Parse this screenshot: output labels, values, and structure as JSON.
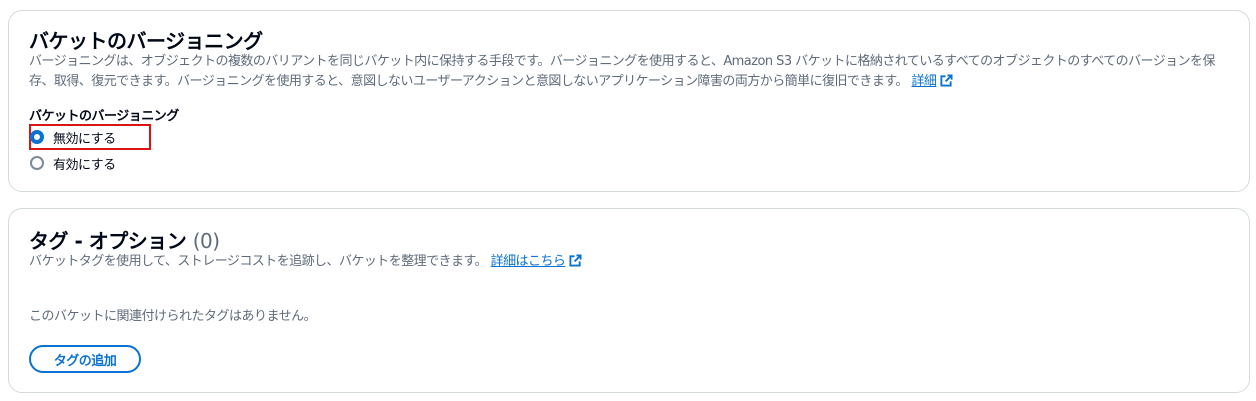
{
  "versioning_section": {
    "title": "バケットのバージョニング",
    "description": "バージョニングは、オブジェクトの複数のバリアントを同じバケット内に保持する手段です。バージョニングを使用すると、Amazon S3 バケットに格納されているすべてのオブジェクトのすべてのバージョンを保存、取得、復元できます。バージョニングを使用すると、意図しないユーザーアクションと意図しないアプリケーション障害の両方から簡単に復旧できます。",
    "learn_more_link": "詳細",
    "field_label": "バケットのバージョニング",
    "options": [
      {
        "label": "無効にする",
        "selected": true
      },
      {
        "label": "有効にする",
        "selected": false
      }
    ],
    "highlight_color": "#d91515"
  },
  "tags_section": {
    "title": "タグ - オプション",
    "count": "(0)",
    "description": "バケットタグを使用して、ストレージコストを追跡し、バケットを整理できます。",
    "learn_more_link": "詳細はこちら",
    "empty_message": "このバケットに関連付けられたタグはありません。",
    "add_tag_button": "タグの追加"
  },
  "icons": {
    "external_link": "external-link-icon"
  },
  "colors": {
    "link": "#0972d3",
    "text": "#000716",
    "secondary_text": "#5f6b7a",
    "border": "#d5dbdb"
  }
}
